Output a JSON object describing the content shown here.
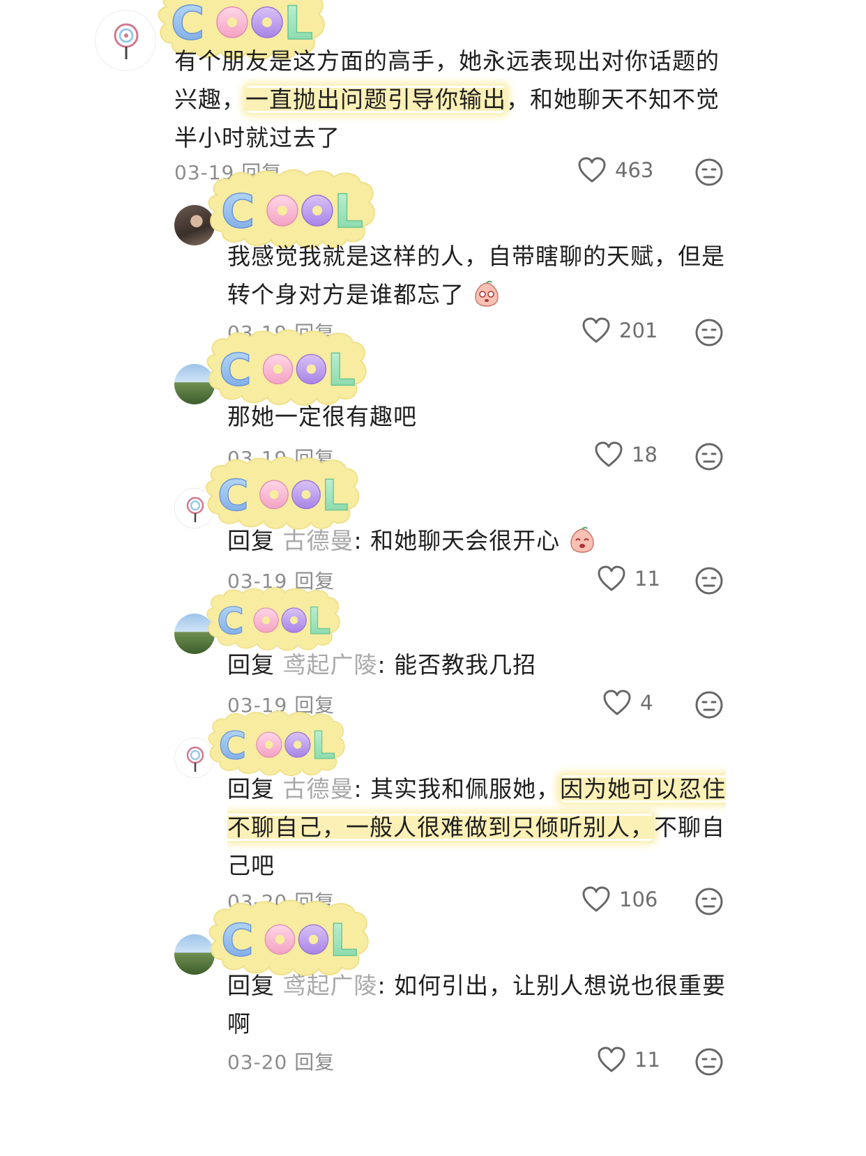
{
  "sticker_text": "COOL",
  "comments": [
    {
      "id": "c1",
      "parts": [
        {
          "t": "有个朋友是这方面的高手，她永远表现出对你话题的兴趣，"
        },
        {
          "t": "一直抛出问题引导你输出",
          "hl": true
        },
        {
          "t": "，和她聊天不知不觉半小时就过去了"
        }
      ],
      "date": "03-19",
      "reply": "回复",
      "likes": "463"
    },
    {
      "id": "c2",
      "parts": [
        {
          "t": "我感觉我就是这样的人，自带瞎聊的天赋，但是转个身对方是谁都忘了"
        }
      ],
      "date": "03-19",
      "reply": "回复",
      "likes": "201"
    },
    {
      "id": "c3",
      "parts": [
        {
          "t": "那她一定很有趣吧"
        }
      ],
      "date": "03-19",
      "reply": "回复",
      "likes": "18"
    },
    {
      "id": "c4",
      "reply_prefix": "回复",
      "mention": "古德曼",
      "parts": [
        {
          "t": ": 和她聊天会很开心"
        }
      ],
      "date": "03-19",
      "reply": "回复",
      "likes": "11"
    },
    {
      "id": "c5",
      "reply_prefix": "回复",
      "mention": "鸢起广陵",
      "parts": [
        {
          "t": ": 能否教我几招"
        }
      ],
      "date": "03-19",
      "reply": "回复",
      "likes": "4"
    },
    {
      "id": "c6",
      "reply_prefix": "回复",
      "mention": "古德曼",
      "parts": [
        {
          "t": ": 其实我和佩服她，"
        },
        {
          "t": "因为她可以忍住不聊自己，一般人很难做到只倾听别人，",
          "hl": true
        },
        {
          "t": "不聊自己吧"
        }
      ],
      "date": "03-20",
      "reply": "回复",
      "likes": "106"
    },
    {
      "id": "c7",
      "reply_prefix": "回复",
      "mention": "鸢起广陵",
      "parts": [
        {
          "t": ": 如何引出，让别人想说也很重要啊"
        }
      ],
      "date": "03-20",
      "reply": "回复",
      "likes": "11"
    }
  ],
  "colors": {
    "highlight": "#fbf0b6",
    "sticker_blob": "#f7eca0",
    "mention": "#a8a8a8",
    "meta": "#8c8c8c"
  },
  "icons": {
    "like": "heart-outline-icon",
    "dislike": "neutral-face-icon",
    "emoji": "peach-face-emoji"
  }
}
